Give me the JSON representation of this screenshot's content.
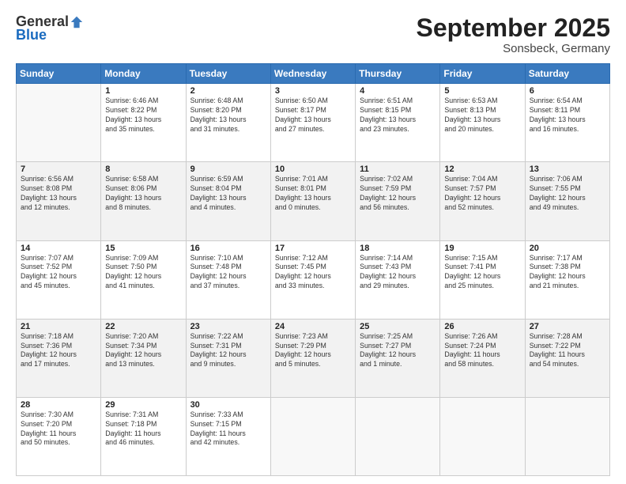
{
  "header": {
    "logo_general": "General",
    "logo_blue": "Blue",
    "title": "September 2025",
    "subtitle": "Sonsbeck, Germany"
  },
  "days_of_week": [
    "Sunday",
    "Monday",
    "Tuesday",
    "Wednesday",
    "Thursday",
    "Friday",
    "Saturday"
  ],
  "weeks": [
    [
      {
        "day": "",
        "info": ""
      },
      {
        "day": "1",
        "info": "Sunrise: 6:46 AM\nSunset: 8:22 PM\nDaylight: 13 hours\nand 35 minutes."
      },
      {
        "day": "2",
        "info": "Sunrise: 6:48 AM\nSunset: 8:20 PM\nDaylight: 13 hours\nand 31 minutes."
      },
      {
        "day": "3",
        "info": "Sunrise: 6:50 AM\nSunset: 8:17 PM\nDaylight: 13 hours\nand 27 minutes."
      },
      {
        "day": "4",
        "info": "Sunrise: 6:51 AM\nSunset: 8:15 PM\nDaylight: 13 hours\nand 23 minutes."
      },
      {
        "day": "5",
        "info": "Sunrise: 6:53 AM\nSunset: 8:13 PM\nDaylight: 13 hours\nand 20 minutes."
      },
      {
        "day": "6",
        "info": "Sunrise: 6:54 AM\nSunset: 8:11 PM\nDaylight: 13 hours\nand 16 minutes."
      }
    ],
    [
      {
        "day": "7",
        "info": "Sunrise: 6:56 AM\nSunset: 8:08 PM\nDaylight: 13 hours\nand 12 minutes."
      },
      {
        "day": "8",
        "info": "Sunrise: 6:58 AM\nSunset: 8:06 PM\nDaylight: 13 hours\nand 8 minutes."
      },
      {
        "day": "9",
        "info": "Sunrise: 6:59 AM\nSunset: 8:04 PM\nDaylight: 13 hours\nand 4 minutes."
      },
      {
        "day": "10",
        "info": "Sunrise: 7:01 AM\nSunset: 8:01 PM\nDaylight: 13 hours\nand 0 minutes."
      },
      {
        "day": "11",
        "info": "Sunrise: 7:02 AM\nSunset: 7:59 PM\nDaylight: 12 hours\nand 56 minutes."
      },
      {
        "day": "12",
        "info": "Sunrise: 7:04 AM\nSunset: 7:57 PM\nDaylight: 12 hours\nand 52 minutes."
      },
      {
        "day": "13",
        "info": "Sunrise: 7:06 AM\nSunset: 7:55 PM\nDaylight: 12 hours\nand 49 minutes."
      }
    ],
    [
      {
        "day": "14",
        "info": "Sunrise: 7:07 AM\nSunset: 7:52 PM\nDaylight: 12 hours\nand 45 minutes."
      },
      {
        "day": "15",
        "info": "Sunrise: 7:09 AM\nSunset: 7:50 PM\nDaylight: 12 hours\nand 41 minutes."
      },
      {
        "day": "16",
        "info": "Sunrise: 7:10 AM\nSunset: 7:48 PM\nDaylight: 12 hours\nand 37 minutes."
      },
      {
        "day": "17",
        "info": "Sunrise: 7:12 AM\nSunset: 7:45 PM\nDaylight: 12 hours\nand 33 minutes."
      },
      {
        "day": "18",
        "info": "Sunrise: 7:14 AM\nSunset: 7:43 PM\nDaylight: 12 hours\nand 29 minutes."
      },
      {
        "day": "19",
        "info": "Sunrise: 7:15 AM\nSunset: 7:41 PM\nDaylight: 12 hours\nand 25 minutes."
      },
      {
        "day": "20",
        "info": "Sunrise: 7:17 AM\nSunset: 7:38 PM\nDaylight: 12 hours\nand 21 minutes."
      }
    ],
    [
      {
        "day": "21",
        "info": "Sunrise: 7:18 AM\nSunset: 7:36 PM\nDaylight: 12 hours\nand 17 minutes."
      },
      {
        "day": "22",
        "info": "Sunrise: 7:20 AM\nSunset: 7:34 PM\nDaylight: 12 hours\nand 13 minutes."
      },
      {
        "day": "23",
        "info": "Sunrise: 7:22 AM\nSunset: 7:31 PM\nDaylight: 12 hours\nand 9 minutes."
      },
      {
        "day": "24",
        "info": "Sunrise: 7:23 AM\nSunset: 7:29 PM\nDaylight: 12 hours\nand 5 minutes."
      },
      {
        "day": "25",
        "info": "Sunrise: 7:25 AM\nSunset: 7:27 PM\nDaylight: 12 hours\nand 1 minute."
      },
      {
        "day": "26",
        "info": "Sunrise: 7:26 AM\nSunset: 7:24 PM\nDaylight: 11 hours\nand 58 minutes."
      },
      {
        "day": "27",
        "info": "Sunrise: 7:28 AM\nSunset: 7:22 PM\nDaylight: 11 hours\nand 54 minutes."
      }
    ],
    [
      {
        "day": "28",
        "info": "Sunrise: 7:30 AM\nSunset: 7:20 PM\nDaylight: 11 hours\nand 50 minutes."
      },
      {
        "day": "29",
        "info": "Sunrise: 7:31 AM\nSunset: 7:18 PM\nDaylight: 11 hours\nand 46 minutes."
      },
      {
        "day": "30",
        "info": "Sunrise: 7:33 AM\nSunset: 7:15 PM\nDaylight: 11 hours\nand 42 minutes."
      },
      {
        "day": "",
        "info": ""
      },
      {
        "day": "",
        "info": ""
      },
      {
        "day": "",
        "info": ""
      },
      {
        "day": "",
        "info": ""
      }
    ]
  ]
}
